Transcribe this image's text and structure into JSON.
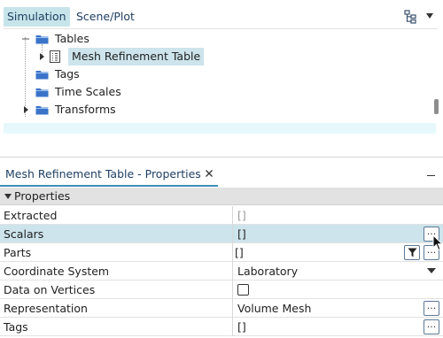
{
  "tree": {
    "tabs": [
      {
        "label": "Simulation",
        "active": true
      },
      {
        "label": "Scene/Plot",
        "active": false
      }
    ],
    "items": [
      {
        "label": "Tables",
        "expanded": true
      },
      {
        "label": "Mesh Refinement Table",
        "selected": true
      },
      {
        "label": "Tags"
      },
      {
        "label": "Time Scales"
      },
      {
        "label": "Transforms",
        "expanded": false
      }
    ]
  },
  "properties": {
    "panel_title": "Mesh Refinement Table - Properties",
    "section_label": "Properties",
    "rows": [
      {
        "name": "Extracted",
        "value": "[]"
      },
      {
        "name": "Scalars",
        "value": "[]",
        "selected": true
      },
      {
        "name": "Parts",
        "value": "[]"
      },
      {
        "name": "Coordinate System",
        "value": "Laboratory"
      },
      {
        "name": "Data on Vertices",
        "value": ""
      },
      {
        "name": "Representation",
        "value": "Volume Mesh"
      },
      {
        "name": "Tags",
        "value": "[]"
      }
    ],
    "ellipsis_label": "..."
  },
  "colors": {
    "accent": "#3c8fb7",
    "active_tab_bg": "#c7e4ea",
    "selection_bg": "#cde4ec",
    "folder_blue": "#3a73c8"
  },
  "icons": {
    "tree_options": "hierarchy-icon",
    "tree_menu": "chevron-down-icon",
    "folder": "folder-icon",
    "table": "table-icon",
    "close": "close-icon",
    "filter": "filter-icon"
  }
}
